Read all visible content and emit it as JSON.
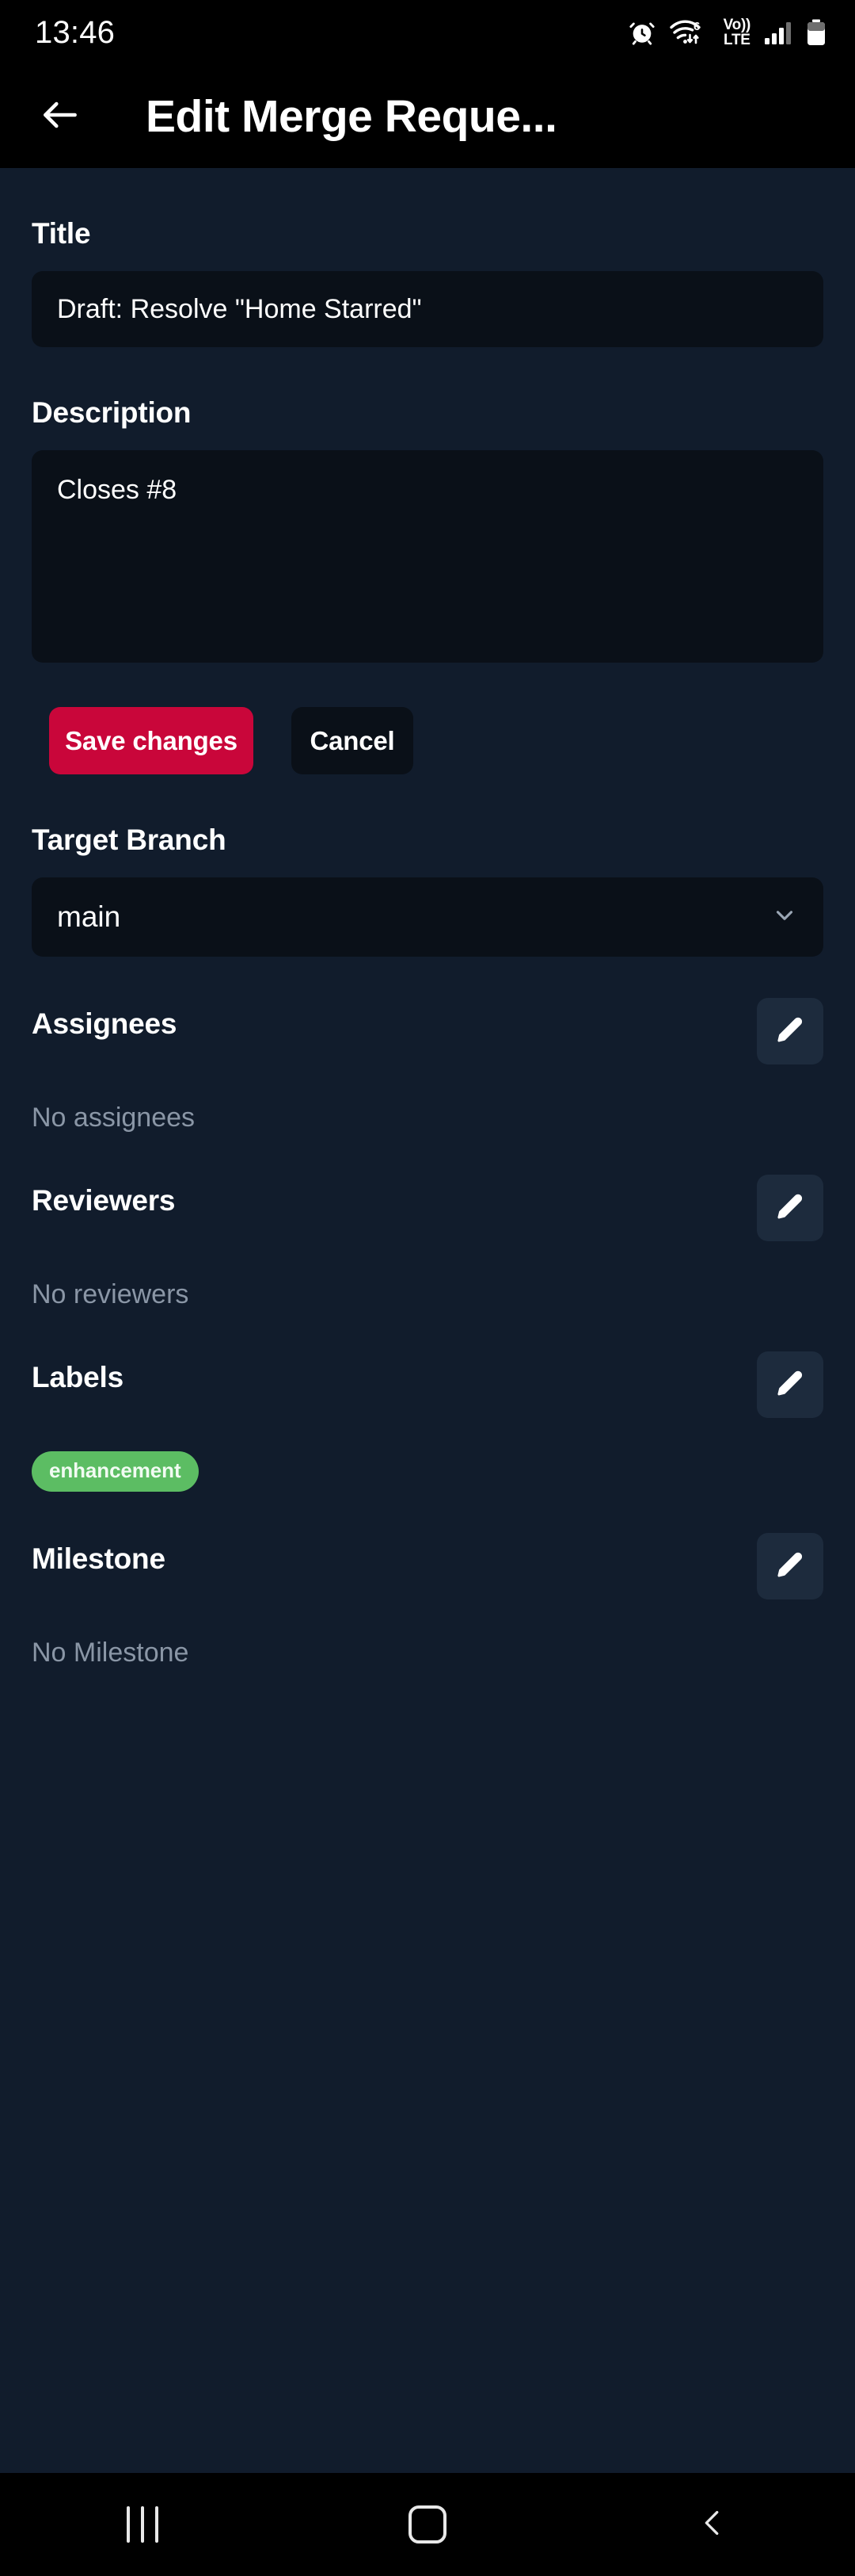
{
  "status_bar": {
    "time": "13:46",
    "icons": [
      "alarm-icon",
      "wifi-6-icon",
      "volte-icon",
      "signal-bars-icon",
      "battery-icon"
    ],
    "volte_top": "Vo))",
    "volte_bottom": "LTE",
    "wifi_generation": "6"
  },
  "app_bar": {
    "back_icon": "arrow-left-icon",
    "title": "Edit Merge Reque..."
  },
  "form": {
    "title_label": "Title",
    "title_value": "Draft: Resolve \"Home Starred\"",
    "description_label": "Description",
    "description_value": "Closes #8",
    "save_label": "Save changes",
    "cancel_label": "Cancel",
    "target_branch_label": "Target Branch",
    "target_branch_value": "main",
    "target_branch_icon": "chevron-down-icon"
  },
  "meta": [
    {
      "label": "Assignees",
      "empty_text": "No assignees",
      "edit_icon": "pencil-icon",
      "badges": []
    },
    {
      "label": "Reviewers",
      "empty_text": "No reviewers",
      "edit_icon": "pencil-icon",
      "badges": []
    },
    {
      "label": "Labels",
      "empty_text": "",
      "edit_icon": "pencil-icon",
      "badges": [
        {
          "text": "enhancement",
          "color": "#5cbd63"
        }
      ]
    },
    {
      "label": "Milestone",
      "empty_text": "No Milestone",
      "edit_icon": "pencil-icon",
      "badges": []
    }
  ],
  "nav_bar": {
    "recents_icon": "recents-icon",
    "home_icon": "home-icon",
    "back_icon": "chevron-left-icon"
  },
  "colors": {
    "background": "#111c2c",
    "field_background": "#0a1018",
    "bar_background": "#000000",
    "accent_red": "#c9063a",
    "label_green": "#5cbd63",
    "muted_text": "#8a96a6"
  }
}
